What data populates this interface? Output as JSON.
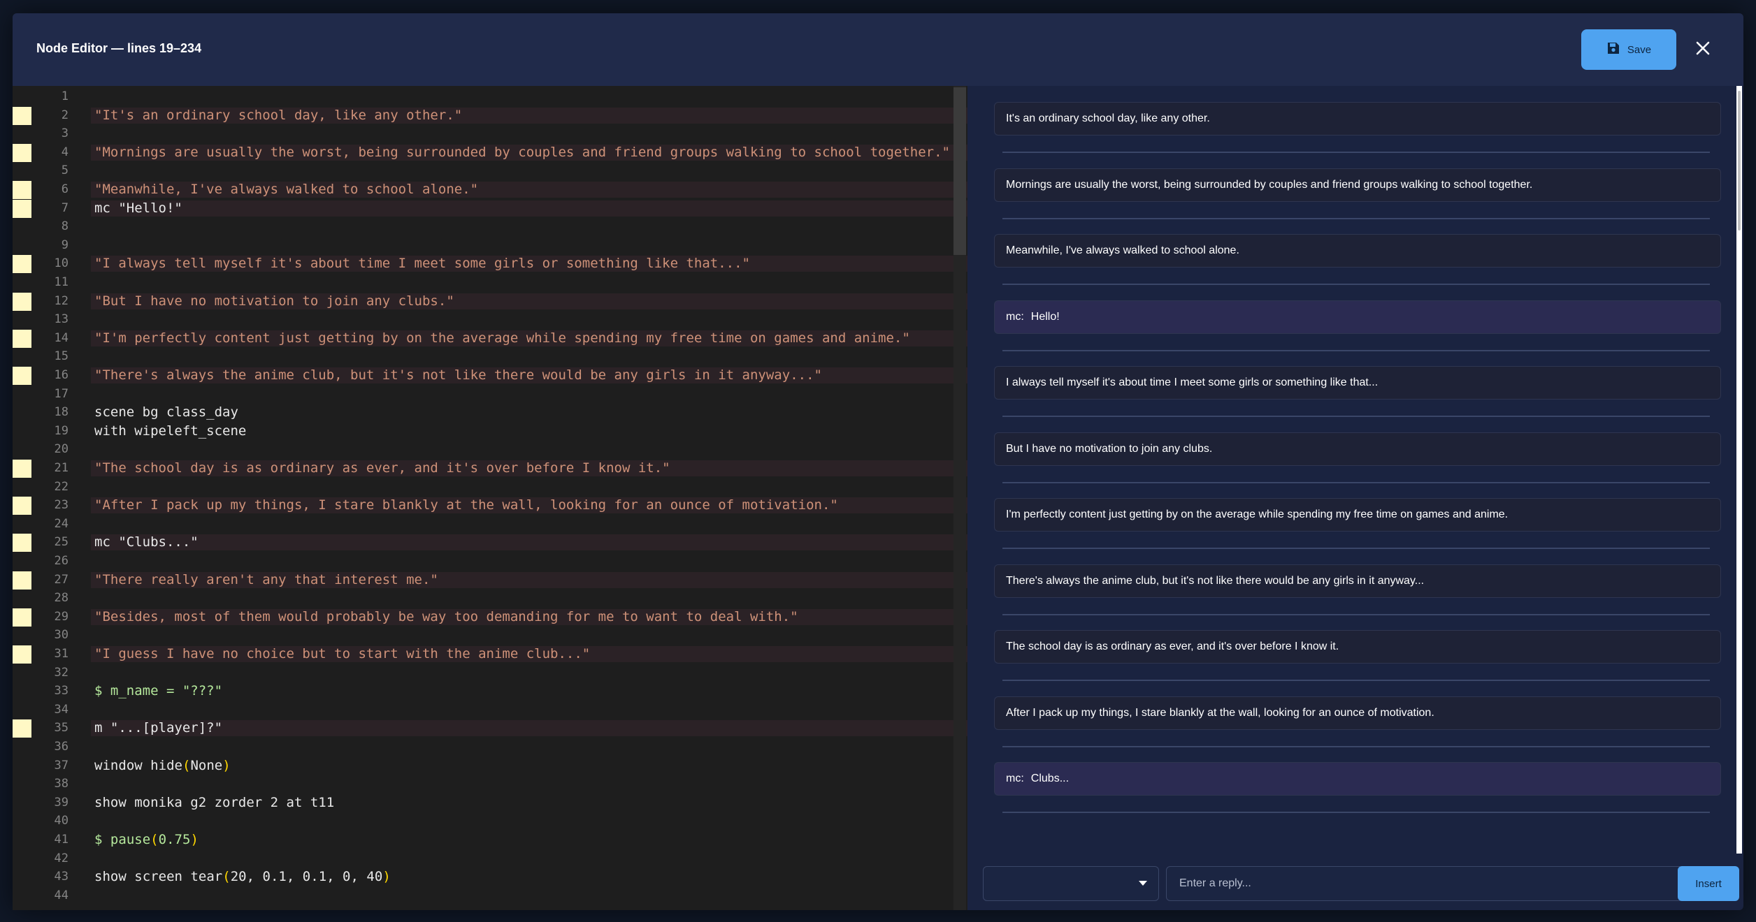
{
  "modal": {
    "title": "Node Editor — lines 19–234",
    "save_label": "Save",
    "save_icon": "floppy-disk-icon",
    "close_icon": "close-icon"
  },
  "editor": {
    "lines": [
      {
        "n": "1",
        "code": "",
        "hl": false,
        "marker": false,
        "cls": "c-plain"
      },
      {
        "n": "2",
        "code": "\"It's an ordinary school day, like any other.\"",
        "hl": true,
        "marker": true,
        "cls": "c-str"
      },
      {
        "n": "3",
        "code": "",
        "hl": false,
        "marker": false,
        "cls": "c-plain"
      },
      {
        "n": "4",
        "code": "\"Mornings are usually the worst, being surrounded by couples and friend groups walking to school together.\"",
        "hl": true,
        "marker": true,
        "cls": "c-str"
      },
      {
        "n": "5",
        "code": "",
        "hl": false,
        "marker": false,
        "cls": "c-plain"
      },
      {
        "n": "6",
        "code": "\"Meanwhile, I've always walked to school alone.\"",
        "hl": true,
        "marker": true,
        "cls": "c-str"
      },
      {
        "n": "7",
        "code": "mc \"Hello!\"",
        "hl": true,
        "marker": true,
        "cls": "c-plain"
      },
      {
        "n": "8",
        "code": "",
        "hl": false,
        "marker": false,
        "cls": "c-plain"
      },
      {
        "n": "9",
        "code": "",
        "hl": false,
        "marker": false,
        "cls": "c-plain"
      },
      {
        "n": "10",
        "code": "\"I always tell myself it's about time I meet some girls or something like that...\"",
        "hl": true,
        "marker": true,
        "cls": "c-str"
      },
      {
        "n": "11",
        "code": "",
        "hl": false,
        "marker": false,
        "cls": "c-plain"
      },
      {
        "n": "12",
        "code": "\"But I have no motivation to join any clubs.\"",
        "hl": true,
        "marker": true,
        "cls": "c-str"
      },
      {
        "n": "13",
        "code": "",
        "hl": false,
        "marker": false,
        "cls": "c-plain"
      },
      {
        "n": "14",
        "code": "\"I'm perfectly content just getting by on the average while spending my free time on games and anime.\"",
        "hl": true,
        "marker": true,
        "cls": "c-str"
      },
      {
        "n": "15",
        "code": "",
        "hl": false,
        "marker": false,
        "cls": "c-plain"
      },
      {
        "n": "16",
        "code": "\"There's always the anime club, but it's not like there would be any girls in it anyway...\"",
        "hl": true,
        "marker": true,
        "cls": "c-str"
      },
      {
        "n": "17",
        "code": "",
        "hl": false,
        "marker": false,
        "cls": "c-plain"
      },
      {
        "n": "18",
        "code": "scene bg class_day",
        "hl": false,
        "marker": false,
        "cls": "c-plain"
      },
      {
        "n": "19",
        "code": "with wipeleft_scene",
        "hl": false,
        "marker": false,
        "cls": "c-plain"
      },
      {
        "n": "20",
        "code": "",
        "hl": false,
        "marker": false,
        "cls": "c-plain"
      },
      {
        "n": "21",
        "code": "\"The school day is as ordinary as ever, and it's over before I know it.\"",
        "hl": true,
        "marker": true,
        "cls": "c-str"
      },
      {
        "n": "22",
        "code": "",
        "hl": false,
        "marker": false,
        "cls": "c-plain"
      },
      {
        "n": "23",
        "code": "\"After I pack up my things, I stare blankly at the wall, looking for an ounce of motivation.\"",
        "hl": true,
        "marker": true,
        "cls": "c-str"
      },
      {
        "n": "24",
        "code": "",
        "hl": false,
        "marker": false,
        "cls": "c-plain"
      },
      {
        "n": "25",
        "code": "mc \"Clubs...\"",
        "hl": true,
        "marker": true,
        "cls": "c-plain"
      },
      {
        "n": "26",
        "code": "",
        "hl": false,
        "marker": false,
        "cls": "c-plain"
      },
      {
        "n": "27",
        "code": "\"There really aren't any that interest me.\"",
        "hl": true,
        "marker": true,
        "cls": "c-str"
      },
      {
        "n": "28",
        "code": "",
        "hl": false,
        "marker": false,
        "cls": "c-plain"
      },
      {
        "n": "29",
        "code": "\"Besides, most of them would probably be way too demanding for me to want to deal with.\"",
        "hl": true,
        "marker": true,
        "cls": "c-str"
      },
      {
        "n": "30",
        "code": "",
        "hl": false,
        "marker": false,
        "cls": "c-plain"
      },
      {
        "n": "31",
        "code": "\"I guess I have no choice but to start with the anime club...\"",
        "hl": true,
        "marker": true,
        "cls": "c-str"
      },
      {
        "n": "32",
        "code": "",
        "hl": false,
        "marker": false,
        "cls": "c-plain"
      },
      {
        "n": "33",
        "code": "$ m_name = \"???\"",
        "hl": false,
        "marker": false,
        "cls": "c-green"
      },
      {
        "n": "34",
        "code": "",
        "hl": false,
        "marker": false,
        "cls": "c-plain"
      },
      {
        "n": "35",
        "code": "m \"...[player]?\"",
        "hl": true,
        "marker": true,
        "cls": "c-plain"
      },
      {
        "n": "36",
        "code": "",
        "hl": false,
        "marker": false,
        "cls": "c-plain"
      },
      {
        "n": "37",
        "code": "window hide(None)",
        "hl": false,
        "marker": false,
        "cls": "c-plain"
      },
      {
        "n": "38",
        "code": "",
        "hl": false,
        "marker": false,
        "cls": "c-plain"
      },
      {
        "n": "39",
        "code": "show monika g2 zorder 2 at t11",
        "hl": false,
        "marker": false,
        "cls": "c-plain"
      },
      {
        "n": "40",
        "code": "",
        "hl": false,
        "marker": false,
        "cls": "c-plain"
      },
      {
        "n": "41",
        "code": "$ pause(0.75)",
        "hl": false,
        "marker": false,
        "cls": "c-green"
      },
      {
        "n": "42",
        "code": "",
        "hl": false,
        "marker": false,
        "cls": "c-plain"
      },
      {
        "n": "43",
        "code": "show screen tear(20, 0.1, 0.1, 0, 40)",
        "hl": false,
        "marker": false,
        "cls": "c-plain"
      },
      {
        "n": "44",
        "code": "",
        "hl": false,
        "marker": false,
        "cls": "c-plain"
      }
    ]
  },
  "chat": {
    "messages": [
      {
        "speaker": "",
        "text": "It's an ordinary school day, like any other."
      },
      {
        "speaker": "",
        "text": "Mornings are usually the worst, being surrounded by couples and friend groups walking to school together."
      },
      {
        "speaker": "",
        "text": "Meanwhile, I've always walked to school alone."
      },
      {
        "speaker": "mc:",
        "text": "Hello!"
      },
      {
        "speaker": "",
        "text": "I always tell myself it's about time I meet some girls or something like that..."
      },
      {
        "speaker": "",
        "text": "But I have no motivation to join any clubs."
      },
      {
        "speaker": "",
        "text": "I'm perfectly content just getting by on the average while spending my free time on games and anime."
      },
      {
        "speaker": "",
        "text": "There's always the anime club, but it's not like there would be any girls in it anyway..."
      },
      {
        "speaker": "",
        "text": "The school day is as ordinary as ever, and it's over before I know it."
      },
      {
        "speaker": "",
        "text": "After I pack up my things, I stare blankly at the wall, looking for an ounce of motivation."
      },
      {
        "speaker": "mc:",
        "text": "Clubs..."
      }
    ]
  },
  "footer": {
    "select_value": "",
    "reply_placeholder": "Enter a reply...",
    "insert_label": "Insert"
  },
  "colors": {
    "accent": "#4fa3f0",
    "marker": "#fff8c5",
    "string": "#ce9178"
  }
}
